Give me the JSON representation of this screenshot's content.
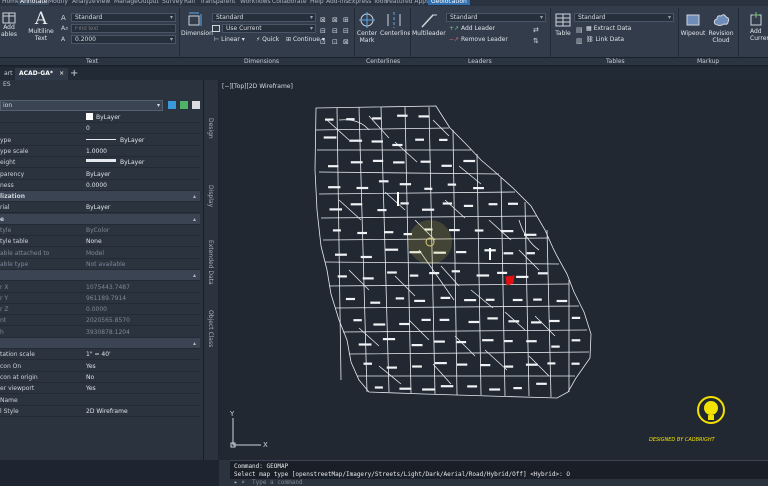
{
  "menu": {
    "tabs": [
      "Home",
      "Annotate",
      "Modify",
      "Analyze",
      "View",
      "Manage",
      "Output",
      "Survey",
      "Rail",
      "Transparent",
      "Workflows",
      "Collaborate",
      "Help",
      "Add-ins",
      "Express Tools",
      "Featured Apps",
      "Geolocation"
    ],
    "active": "Annotate",
    "highlight": "Geolocation"
  },
  "ribbon": {
    "text_group": {
      "add_tables_label": "Add\nables",
      "multiline_text_label": "Multiline\nText",
      "text_style": "Standard",
      "find_text_placeholder": "Find text",
      "text_height": "0.2000"
    },
    "dimensions_group": {
      "dimension_label": "Dimension",
      "dim_style": "Standard",
      "use_current": "Use Current",
      "linear": "Linear",
      "quick": "Quick",
      "continue": "Continue"
    },
    "centerlines_group": {
      "center_mark": "Center\nMark",
      "centerline": "Centerline"
    },
    "leaders_group": {
      "multileader": "Multileader",
      "leader_style": "Standard",
      "add_leader": "Add Leader",
      "remove_leader": "Remove Leader"
    },
    "tables_group": {
      "table": "Table",
      "table_style": "Standard",
      "extract_data": "Extract Data",
      "link_data": "Link Data"
    },
    "markup_group": {
      "wipeout": "Wipeout",
      "revision_cloud": "Revision\nCloud",
      "add_current": "Add\nCurrent S"
    },
    "panel_labels": [
      "Text",
      "Dimensions",
      "Centerlines",
      "Leaders",
      "Tables",
      "Markup"
    ]
  },
  "doc_tabs": [
    {
      "label": "art",
      "active": false
    },
    {
      "label": "ACAD-GA*",
      "active": true
    }
  ],
  "properties": {
    "title": "ES",
    "selection": "ion",
    "rows": [
      {
        "k": "",
        "v": "ByLayer",
        "swatch": true
      },
      {
        "k": "",
        "v": "0"
      },
      {
        "k": "ype",
        "v": "ByLayer",
        "line": true
      },
      {
        "k": "ype scale",
        "v": "1.0000"
      },
      {
        "k": "eight",
        "v": "ByLayer",
        "thick": true
      },
      {
        "k": "parency",
        "v": "ByLayer"
      },
      {
        "k": "ness",
        "v": "0.0000"
      },
      {
        "k": "lization",
        "v": "",
        "sec": true
      },
      {
        "k": "rial",
        "v": "ByLayer"
      },
      {
        "k": "e",
        "v": "",
        "sec": true
      },
      {
        "k": "tyle",
        "v": "ByColor",
        "dim": true
      },
      {
        "k": "tyle table",
        "v": "None"
      },
      {
        "k": "able attached to",
        "v": "Model",
        "dim": true
      },
      {
        "k": "able type",
        "v": "Not available",
        "dim": true
      },
      {
        "k": "",
        "v": "",
        "sec": true
      },
      {
        "k": "r X",
        "v": "1075443.7487",
        "dim": true
      },
      {
        "k": "r Y",
        "v": "961189.7914",
        "dim": true
      },
      {
        "k": "r Z",
        "v": "0.0000",
        "dim": true
      },
      {
        "k": "nt",
        "v": "2020565.8570",
        "dim": true
      },
      {
        "k": "h",
        "v": "3930878.1204",
        "dim": true
      },
      {
        "k": "",
        "v": "",
        "sec": true
      },
      {
        "k": "tation scale",
        "v": "1\" = 40'"
      },
      {
        "k": "con On",
        "v": "Yes"
      },
      {
        "k": "con at origin",
        "v": "No"
      },
      {
        "k": "er viewport",
        "v": "Yes"
      },
      {
        "k": "Name",
        "v": ""
      },
      {
        "k": "l Style",
        "v": "2D Wireframe"
      }
    ],
    "side_tabs": [
      "Design",
      "Display",
      "Extended Data",
      "Object Class"
    ]
  },
  "viewport": {
    "label": "[−][Top][2D Wireframe]",
    "credit": "DESIGNED BY CADBRIGHT"
  },
  "command": {
    "line1": "Command: GEOMAP",
    "line2": "Select map type [openstreetMap/Imagery/Streets/Light/Dark/Aerial/Road/Hybrid/Off] <Hybrid>: O",
    "placeholder": "Type a command"
  },
  "colors": {
    "accent": "#2f6fb0",
    "highlight_county": "#e01010",
    "bulb": "#f3e100"
  }
}
